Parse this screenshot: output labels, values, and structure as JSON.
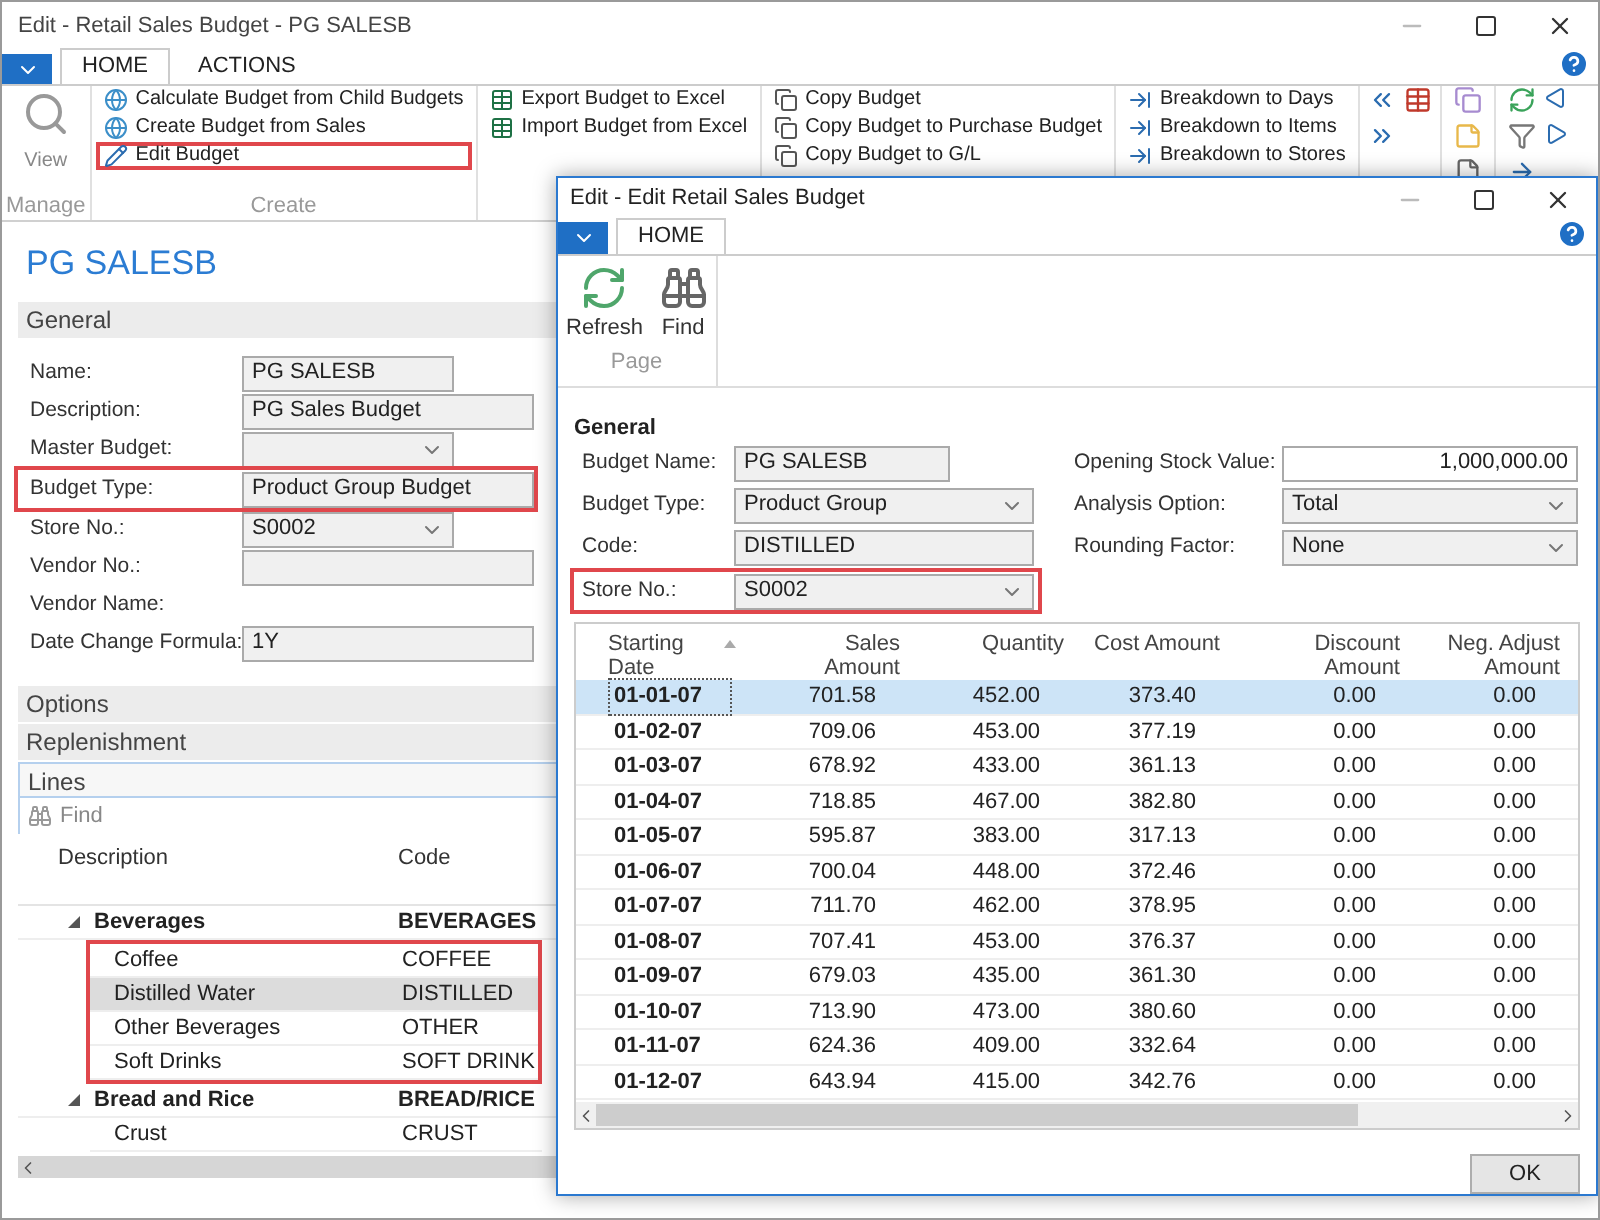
{
  "main_window": {
    "title": "Edit - Retail Sales Budget - PG SALESB"
  },
  "ribbon": {
    "tabs": [
      {
        "label": "HOME",
        "selected": true
      },
      {
        "label": "ACTIONS",
        "selected": false
      }
    ],
    "groups": [
      {
        "kind": "large",
        "caption": "Manage",
        "items": [
          {
            "label": "View",
            "highlighted": false
          }
        ]
      },
      {
        "kind": "create",
        "caption": "Create",
        "items": [
          {
            "label": "Calculate Budget from Child Budgets",
            "highlighted": false
          },
          {
            "label": "Create Budget from Sales",
            "highlighted": false
          },
          {
            "label": "Edit Budget",
            "highlighted": true
          }
        ]
      },
      {
        "kind": "excel",
        "items": [
          {
            "label": "Export Budget to Excel",
            "highlighted": false
          },
          {
            "label": "Import Budget from Excel",
            "highlighted": false
          }
        ]
      },
      {
        "kind": "copy",
        "items": [
          {
            "label": "Copy Budget",
            "highlighted": false
          },
          {
            "label": "Copy Budget to Purchase Budget",
            "highlighted": false
          },
          {
            "label": "Copy Budget to G/L",
            "highlighted": false
          }
        ]
      },
      {
        "kind": "breakdown",
        "items": [
          {
            "label": "Breakdown to Days",
            "highlighted": false
          },
          {
            "label": "Breakdown to Items",
            "highlighted": false
          },
          {
            "label": "Breakdown to Stores",
            "highlighted": false
          }
        ]
      }
    ]
  },
  "page": {
    "title": "PG SALESB",
    "general": {
      "heading": "General",
      "fields": [
        {
          "label": "Name:",
          "value": "PG SALESB",
          "kind": "text",
          "wide": false,
          "highlighted": false
        },
        {
          "label": "Description:",
          "value": "PG Sales Budget",
          "kind": "text",
          "wide": true,
          "highlighted": false
        },
        {
          "label": "Master Budget:",
          "kind": "select",
          "wide": false,
          "highlighted": false
        },
        {
          "label": "Budget Type:",
          "value": "Product Group Budget",
          "kind": "text",
          "wide": true,
          "highlighted": true
        },
        {
          "label": "Store No.:",
          "value": "S0002",
          "kind": "select",
          "wide": false,
          "highlighted": false
        },
        {
          "label": "Vendor No.:",
          "kind": "text",
          "wide": true,
          "highlighted": false
        },
        {
          "label": "Vendor Name:",
          "kind": "none",
          "highlighted": false
        },
        {
          "label": "Date Change Formula:",
          "value": "1Y",
          "kind": "text",
          "wide": true,
          "highlighted": false
        }
      ]
    },
    "sections": [
      "Options",
      "Replenishment"
    ],
    "lines": {
      "heading": "Lines",
      "find": "Find",
      "columns": [
        "Description",
        "Code"
      ],
      "rows": [
        {
          "description": "Beverages",
          "code": "BEVERAGES",
          "expanded": true,
          "selected": false,
          "boxed": true,
          "children": [
            {
              "description": "Coffee",
              "code": "COFFEE",
              "selected": false
            },
            {
              "description": "Distilled Water",
              "code": "DISTILLED",
              "selected": true
            },
            {
              "description": "Other Beverages",
              "code": "OTHER",
              "selected": false
            },
            {
              "description": "Soft Drinks",
              "code": "SOFT DRINK",
              "selected": false
            }
          ]
        },
        {
          "description": "Bread and Rice",
          "code": "BREAD/RICE",
          "expanded": true,
          "selected": false,
          "boxed": false,
          "children": [
            {
              "description": "Crust",
              "code": "CRUST",
              "selected": false
            }
          ]
        }
      ]
    }
  },
  "dialog": {
    "title": "Edit - Edit Retail Sales Budget",
    "tabs": [
      {
        "label": "HOME",
        "selected": true
      }
    ],
    "actions": [
      {
        "label": "Refresh",
        "kind": "refresh"
      },
      {
        "label": "Find",
        "kind": "find"
      }
    ],
    "group_caption": "Page",
    "general": {
      "heading": "General",
      "left_fields": [
        {
          "label": "Budget Name:",
          "value": "PG SALESB",
          "kind": "text",
          "highlighted": false
        },
        {
          "label": "Budget Type:",
          "value": "Product Group",
          "kind": "select",
          "highlighted": false
        },
        {
          "label": "Code:",
          "value": "DISTILLED",
          "kind": "text",
          "highlighted": false
        },
        {
          "label": "Store No.:",
          "value": "S0002",
          "kind": "select",
          "highlighted": true
        }
      ],
      "right_fields": [
        {
          "label": "Opening Stock Value:",
          "value": "1,000,000.00",
          "kind": "number"
        },
        {
          "label": "Analysis Option:",
          "value": "Total",
          "kind": "select"
        },
        {
          "label": "Rounding Factor:",
          "value": "None",
          "kind": "select"
        }
      ]
    },
    "table": {
      "columns": [
        {
          "label": "Starting Date",
          "sorted": true
        },
        {
          "label": "Sales Amount",
          "sorted": false
        },
        {
          "label": "Quantity",
          "sorted": false
        },
        {
          "label": "Cost Amount",
          "sorted": false
        },
        {
          "label": "Discount Amount",
          "sorted": false
        },
        {
          "label": "Neg. Adjust Amount",
          "sorted": false
        }
      ],
      "rows": [
        {
          "cells": [
            "01-01-07",
            "701.58",
            "452.00",
            "373.40",
            "0.00",
            "0.00"
          ],
          "selected": true
        },
        {
          "cells": [
            "01-02-07",
            "709.06",
            "453.00",
            "377.19",
            "0.00",
            "0.00"
          ],
          "selected": false
        },
        {
          "cells": [
            "01-03-07",
            "678.92",
            "433.00",
            "361.13",
            "0.00",
            "0.00"
          ],
          "selected": false
        },
        {
          "cells": [
            "01-04-07",
            "718.85",
            "467.00",
            "382.80",
            "0.00",
            "0.00"
          ],
          "selected": false
        },
        {
          "cells": [
            "01-05-07",
            "595.87",
            "383.00",
            "317.13",
            "0.00",
            "0.00"
          ],
          "selected": false
        },
        {
          "cells": [
            "01-06-07",
            "700.04",
            "448.00",
            "372.46",
            "0.00",
            "0.00"
          ],
          "selected": false
        },
        {
          "cells": [
            "01-07-07",
            "711.70",
            "462.00",
            "378.95",
            "0.00",
            "0.00"
          ],
          "selected": false
        },
        {
          "cells": [
            "01-08-07",
            "707.41",
            "453.00",
            "376.37",
            "0.00",
            "0.00"
          ],
          "selected": false
        },
        {
          "cells": [
            "01-09-07",
            "679.03",
            "435.00",
            "361.30",
            "0.00",
            "0.00"
          ],
          "selected": false
        },
        {
          "cells": [
            "01-10-07",
            "713.90",
            "473.00",
            "380.60",
            "0.00",
            "0.00"
          ],
          "selected": false
        },
        {
          "cells": [
            "01-11-07",
            "624.36",
            "409.00",
            "332.64",
            "0.00",
            "0.00"
          ],
          "selected": false
        },
        {
          "cells": [
            "01-12-07",
            "643.94",
            "415.00",
            "342.76",
            "0.00",
            "0.00"
          ],
          "selected": false
        }
      ]
    },
    "ok_button": "OK"
  }
}
